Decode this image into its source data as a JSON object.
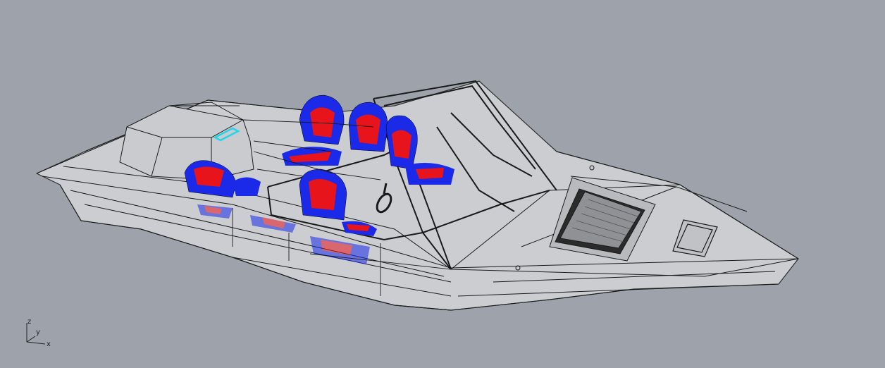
{
  "viewport": {
    "background": "#9ea3ab",
    "model": "boat-wireframe-shaded",
    "colors": {
      "hull_fill": "#cfd1d4",
      "wire": "#1a1a1a",
      "seat_primary": "#1a2ae8",
      "seat_secondary": "#e8141c",
      "highlight": "#21d6e8"
    }
  },
  "axis_widget": {
    "z": "z",
    "y": "y",
    "x": "x"
  }
}
